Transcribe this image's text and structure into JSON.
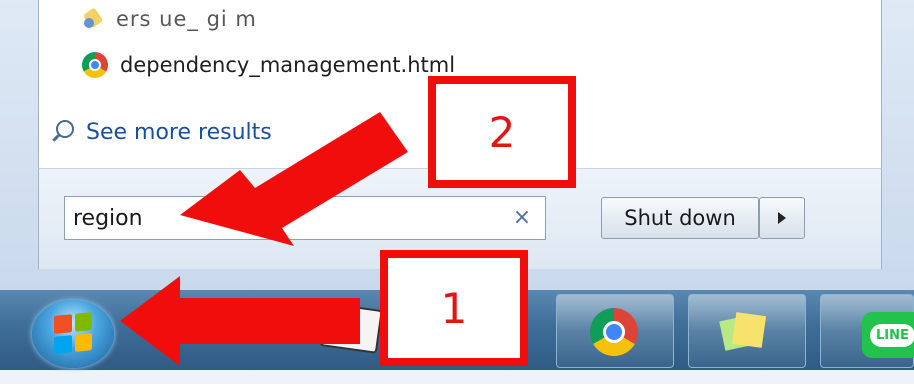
{
  "start_menu": {
    "results": [
      {
        "label": "ers ue_ gi m",
        "icon": "document-icon"
      },
      {
        "label": "dependency_management.html",
        "icon": "chrome-icon"
      }
    ],
    "see_more_label": "See more results",
    "search": {
      "value": "region",
      "clear_glyph": "×"
    },
    "shutdown_label": "Shut down"
  },
  "taskbar": {
    "line_label": "LINE"
  },
  "annotations": {
    "step1": "1",
    "step2": "2",
    "color": "#f20d0d"
  }
}
